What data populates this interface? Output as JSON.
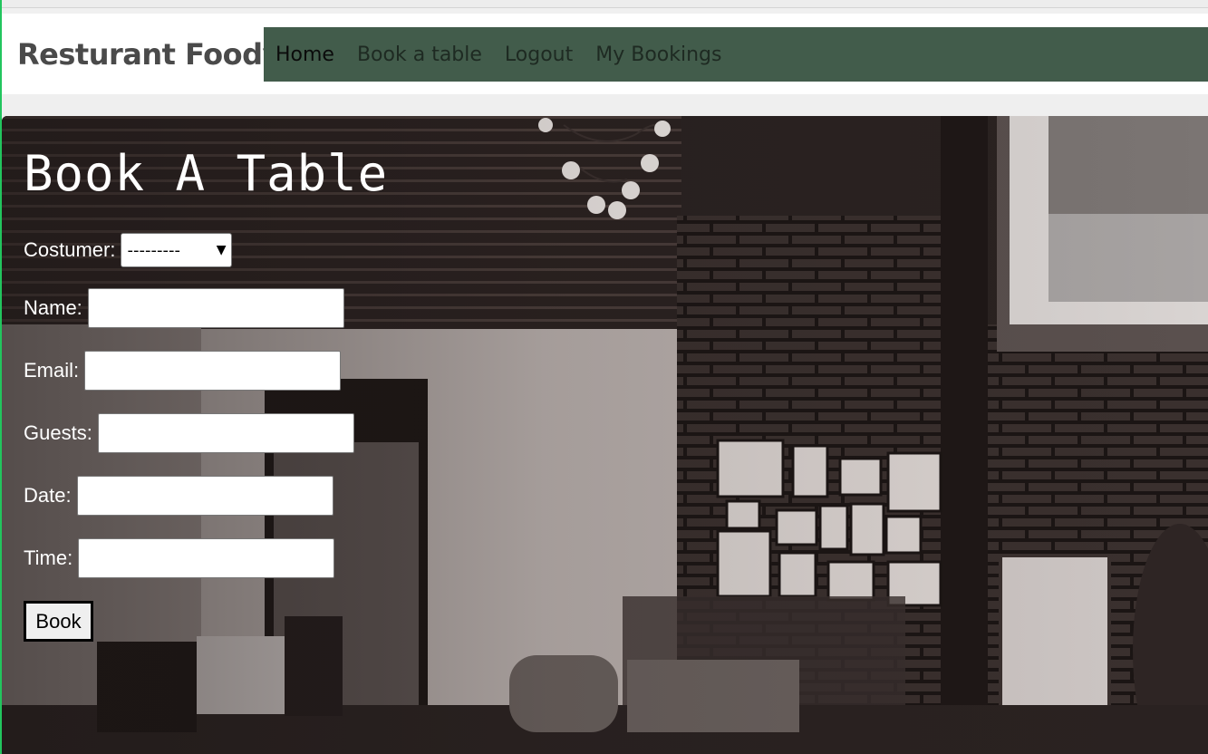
{
  "brand": "Resturant Foody",
  "nav": {
    "items": [
      {
        "label": "Home"
      },
      {
        "label": "Book a table"
      },
      {
        "label": "Logout"
      },
      {
        "label": "My Bookings"
      }
    ]
  },
  "form": {
    "title": "Book A Table",
    "customer_label": "Costumer:",
    "customer_selected": "---------",
    "name_label": "Name:",
    "email_label": "Email:",
    "guests_label": "Guests:",
    "date_label": "Date:",
    "time_label": "Time:",
    "submit_label": "Book"
  },
  "colors": {
    "nav_bg": "#425c4b",
    "accent_green": "#22c55e"
  }
}
